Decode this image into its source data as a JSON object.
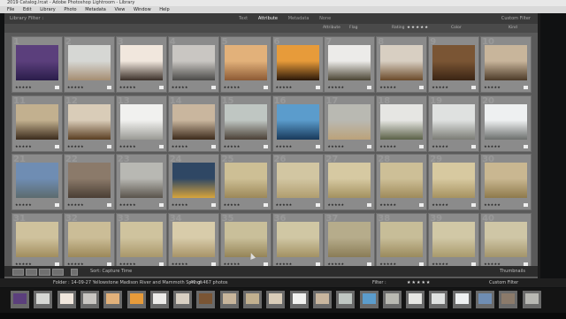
{
  "window_title": "2019 Catalog.lrcat - Adobe Photoshop Lightroom - Library",
  "menu": [
    "File",
    "Edit",
    "Library",
    "Photo",
    "Metadata",
    "View",
    "Window",
    "Help"
  ],
  "filter_bar": {
    "title": "Library Filter :",
    "tabs": [
      {
        "label": "Text",
        "active": false
      },
      {
        "label": "Attribute",
        "active": true
      },
      {
        "label": "Metadata",
        "active": false
      },
      {
        "label": "None",
        "active": false
      }
    ],
    "preset": "Custom Filter",
    "attribute_label": "Attribute",
    "flag_label": "Flag",
    "rating_label": "Rating",
    "rating_stars": "★★★★★",
    "color_label": "Color",
    "kind_label": "Kind"
  },
  "grid_rows": [
    [
      {
        "num": "1",
        "colors": [
          "#5b3f7c",
          "#2a1d4a"
        ]
      },
      {
        "num": "2",
        "colors": [
          "#d6d7d4",
          "#a58d72"
        ]
      },
      {
        "num": "3",
        "colors": [
          "#f1e7dd",
          "#3b3029"
        ]
      },
      {
        "num": "4",
        "colors": [
          "#c9c6c2",
          "#4b4a48"
        ]
      },
      {
        "num": "5",
        "colors": [
          "#e2b17a",
          "#8c5a35"
        ]
      },
      {
        "num": "6",
        "colors": [
          "#e79b3a",
          "#2a1709"
        ]
      },
      {
        "num": "7",
        "colors": [
          "#ecebe9",
          "#4a4433"
        ]
      },
      {
        "num": "8",
        "colors": [
          "#d8cfc2",
          "#6b4a2a"
        ]
      },
      {
        "num": "9",
        "colors": [
          "#7a5534",
          "#3a2414"
        ]
      },
      {
        "num": "10",
        "colors": [
          "#c8b59b",
          "#4c3a28"
        ]
      }
    ],
    [
      {
        "num": "11",
        "colors": [
          "#c2b08f",
          "#3b2b1c"
        ]
      },
      {
        "num": "12",
        "colors": [
          "#d9ccb8",
          "#5a3e22"
        ]
      },
      {
        "num": "13",
        "colors": [
          "#f1f1ef",
          "#9a9a95"
        ]
      },
      {
        "num": "14",
        "colors": [
          "#c9b69e",
          "#3c2a1b"
        ]
      },
      {
        "num": "15",
        "colors": [
          "#bfc6c2",
          "#4b4036"
        ]
      },
      {
        "num": "16",
        "colors": [
          "#5b9ccc",
          "#18395a"
        ]
      },
      {
        "num": "17",
        "colors": [
          "#b9b9b2",
          "#bba27a"
        ]
      },
      {
        "num": "18",
        "colors": [
          "#e6e6e3",
          "#5b6147"
        ]
      },
      {
        "num": "19",
        "colors": [
          "#dfe1e0",
          "#7b7c75"
        ]
      },
      {
        "num": "20",
        "colors": [
          "#eef0f1",
          "#6c6f6d"
        ]
      }
    ],
    [
      {
        "num": "21",
        "colors": [
          "#6f8db3",
          "#5c6b6e"
        ]
      },
      {
        "num": "22",
        "colors": [
          "#8b7a6a",
          "#4a3e34"
        ]
      },
      {
        "num": "23",
        "colors": [
          "#b8b8b3",
          "#5a544c"
        ]
      },
      {
        "num": "24",
        "colors": [
          "#2f4764",
          "#d7a43c"
        ]
      },
      {
        "num": "25",
        "colors": [
          "#cdbf95",
          "#9c8859"
        ]
      },
      {
        "num": "26",
        "colors": [
          "#d2c6a2",
          "#b09d6f"
        ]
      },
      {
        "num": "27",
        "colors": [
          "#d6c9a2",
          "#a3915f"
        ]
      },
      {
        "num": "28",
        "colors": [
          "#cdbf97",
          "#9f8b5b"
        ]
      },
      {
        "num": "29",
        "colors": [
          "#d7c9a0",
          "#a69260"
        ]
      },
      {
        "num": "30",
        "colors": [
          "#c9b791",
          "#8e7a4c"
        ]
      }
    ],
    [
      {
        "num": "31",
        "colors": [
          "#cfc29d",
          "#a18d5e"
        ]
      },
      {
        "num": "32",
        "colors": [
          "#cbbd97",
          "#9c8859"
        ]
      },
      {
        "num": "33",
        "colors": [
          "#cfc39e",
          "#a9976a"
        ]
      },
      {
        "num": "34",
        "colors": [
          "#d8ccaa",
          "#a89468"
        ]
      },
      {
        "num": "35",
        "colors": [
          "#c9bf9a",
          "#958457"
        ]
      },
      {
        "num": "36",
        "colors": [
          "#d0c7a4",
          "#a29163"
        ]
      },
      {
        "num": "37",
        "colors": [
          "#b6ac8b",
          "#8a7c56"
        ]
      },
      {
        "num": "38",
        "colors": [
          "#c7bd98",
          "#9a8a5d"
        ]
      },
      {
        "num": "39",
        "colors": [
          "#d1c8a6",
          "#a99a6c"
        ]
      },
      {
        "num": "40",
        "colors": [
          "#cfc6a6",
          "#a3946a"
        ]
      }
    ]
  ],
  "star_text": "★★★★★",
  "toolbar": {
    "sort_label": "Sort:",
    "sort_value": "Capture Time",
    "thumbnails_label": "Thumbnails"
  },
  "filmstrip": {
    "folder": "Folder : 14-09-27 Yellowstone Madison River and Mammoth Springs",
    "count": "40 of 467 photos",
    "filter_label": "Filter :",
    "filter_stars": "★★★★★",
    "custom": "Custom Filter",
    "thumbs": [
      "#5b3f7c",
      "#d6d7d4",
      "#f1e7dd",
      "#c9c6c2",
      "#e2b17a",
      "#e79b3a",
      "#ecebe9",
      "#d8cfc2",
      "#7a5534",
      "#c8b59b",
      "#c2b08f",
      "#d9ccb8",
      "#f1f1ef",
      "#c9b69e",
      "#bfc6c2",
      "#5b9ccc",
      "#b9b9b2",
      "#e6e6e3",
      "#dfe1e0",
      "#eef0f1",
      "#6f8db3",
      "#8b7a6a",
      "#b8b8b3"
    ]
  },
  "colors": {
    "accent": "#bdbdbd",
    "grid_bg": "#5a5a5a"
  }
}
